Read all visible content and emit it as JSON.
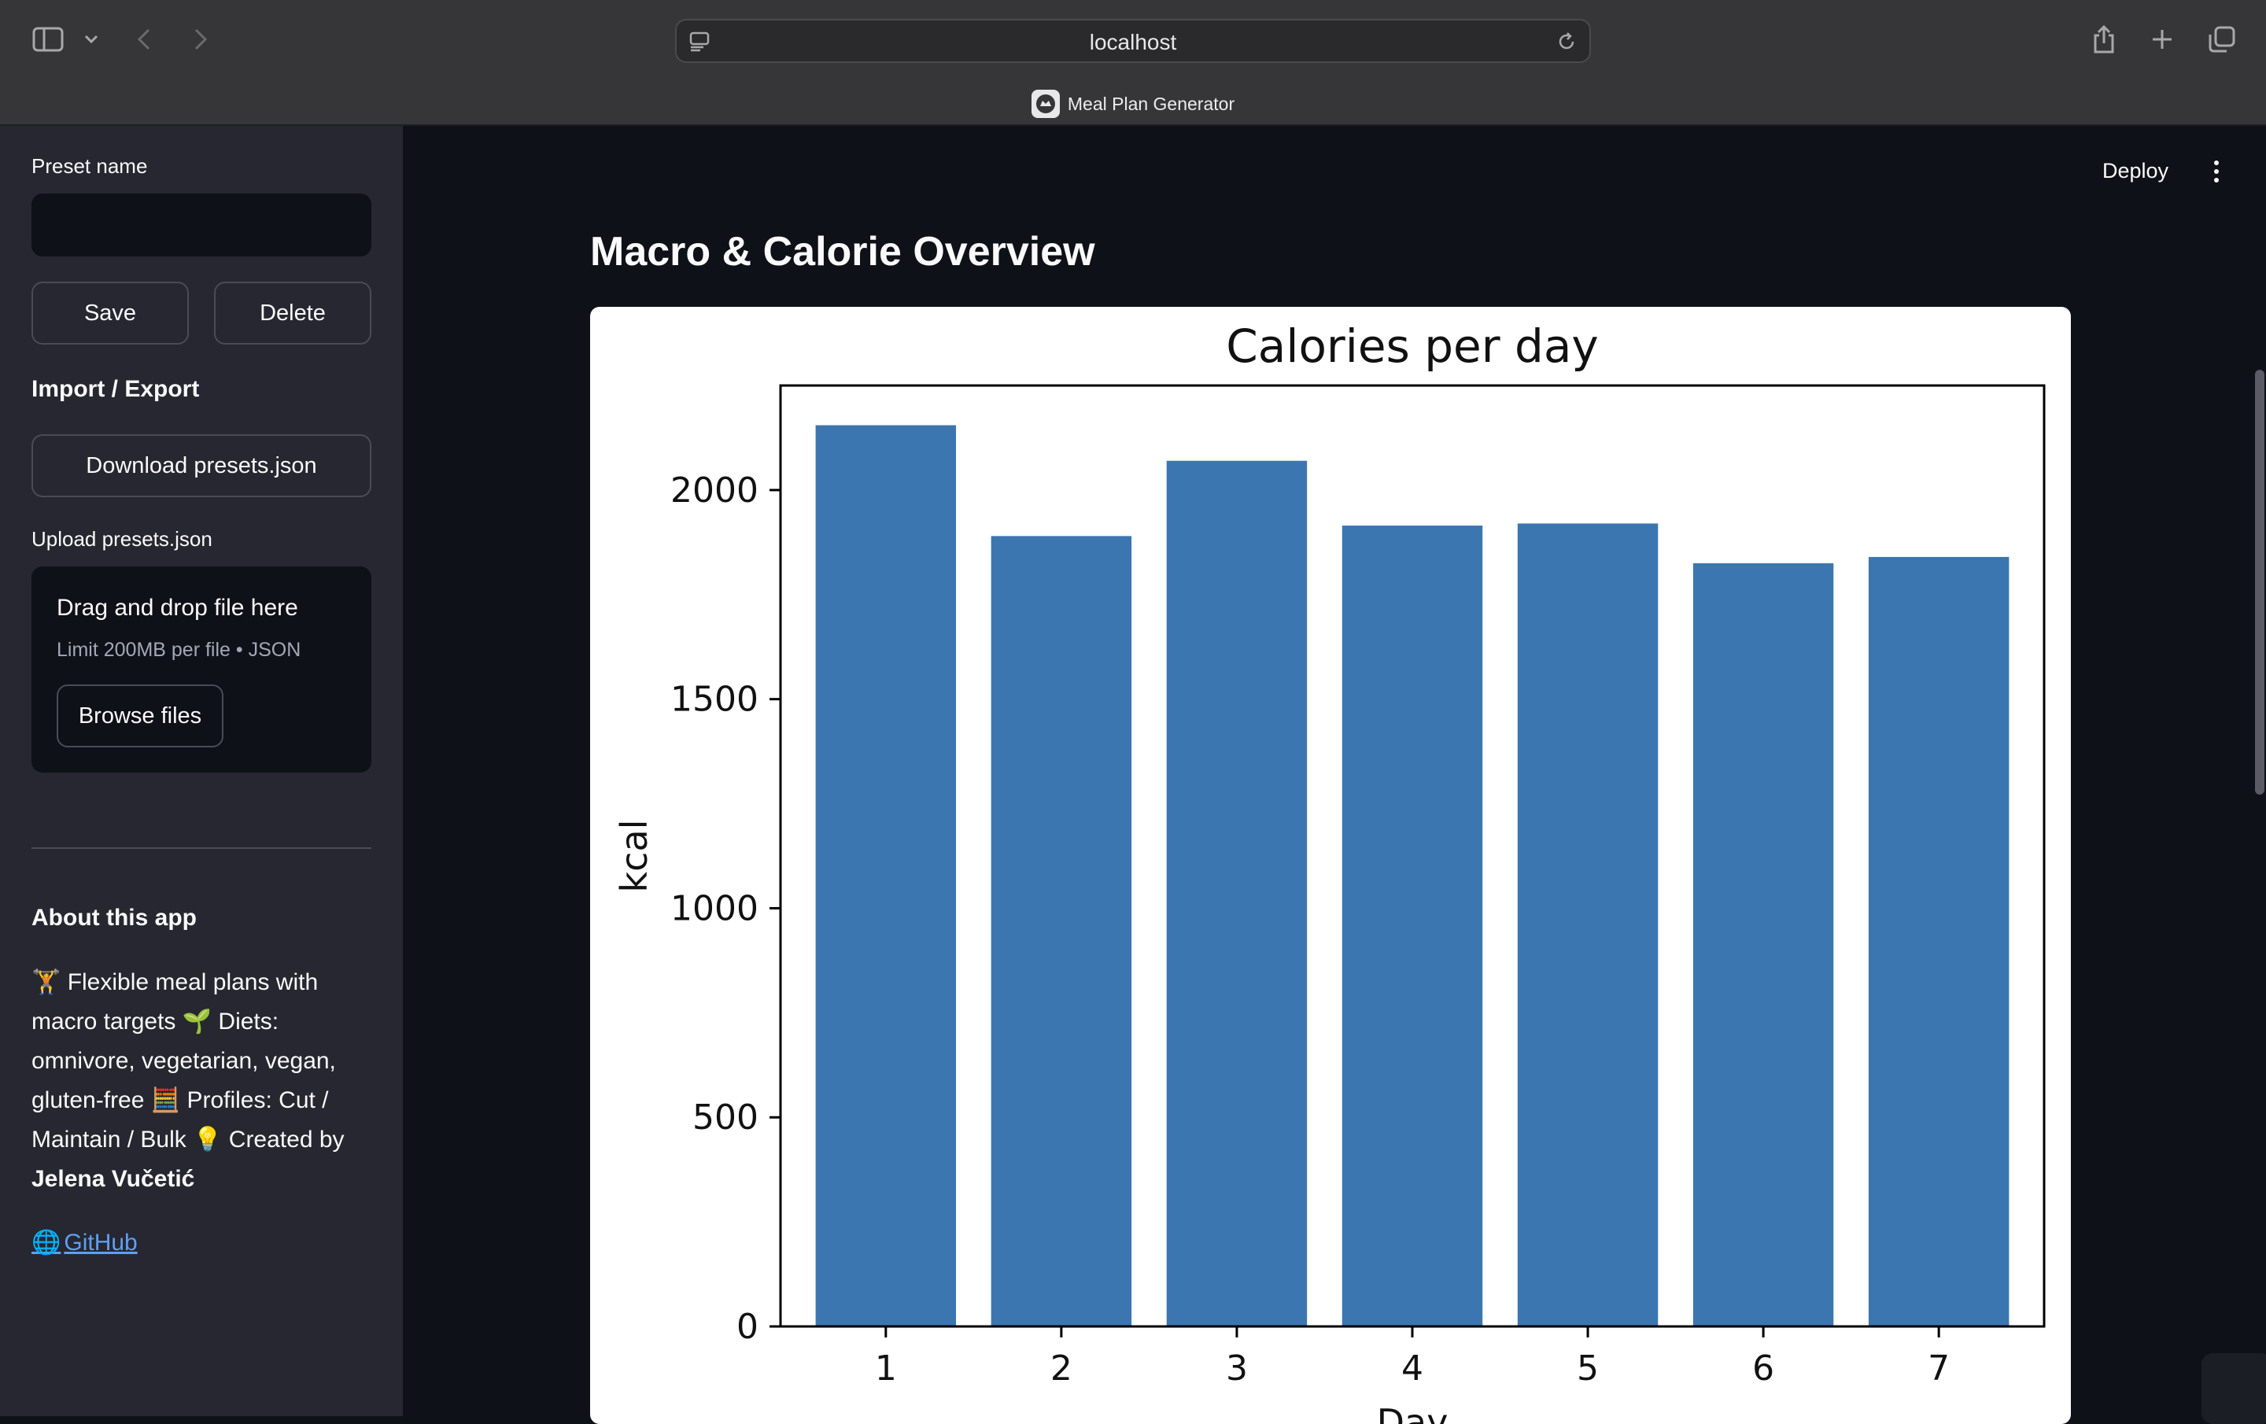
{
  "browser": {
    "url": "localhost",
    "tab_title": "Meal Plan Generator"
  },
  "sidebar": {
    "preset_name_label": "Preset name",
    "preset_name_value": "",
    "save_label": "Save",
    "delete_label": "Delete",
    "import_export_heading": "Import / Export",
    "download_label": "Download presets.json",
    "upload_label": "Upload presets.json",
    "dropzone_title": "Drag and drop file here",
    "dropzone_limit": "Limit 200MB per file • JSON",
    "browse_label": "Browse files",
    "about_heading": "About this app",
    "about_text_1": "🏋️ Flexible meal plans with macro targets 🌱 Diets: omnivore, vegetarian, vegan, gluten-free 🧮 Profiles: Cut / Maintain / Bulk 💡 Created by",
    "about_author": "Jelena Vučetić",
    "github_label": "GitHub"
  },
  "header": {
    "deploy_label": "Deploy"
  },
  "main": {
    "title": "Macro & Calorie Overview"
  },
  "colors": {
    "bar": "#3b76b0",
    "accent_link": "#5e9ff5"
  },
  "chart_data": {
    "type": "bar",
    "title": "Calories per day",
    "xlabel": "Day",
    "ylabel": "kcal",
    "categories": [
      "1",
      "2",
      "3",
      "4",
      "5",
      "6",
      "7"
    ],
    "values": [
      2155,
      1890,
      2070,
      1915,
      1920,
      1825,
      1840
    ],
    "ylim": [
      0,
      2250
    ],
    "yticks": [
      0,
      500,
      1000,
      1500,
      2000
    ],
    "grid": false,
    "legend": "none"
  }
}
